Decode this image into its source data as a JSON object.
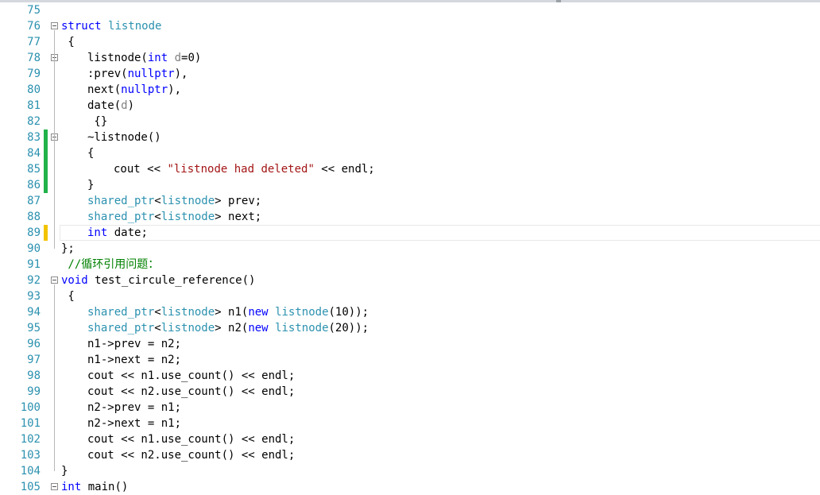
{
  "editor": {
    "lines": [
      {
        "num": "75",
        "indent": 0,
        "fold": false,
        "change": "",
        "tokens": []
      },
      {
        "num": "76",
        "indent": 0,
        "fold": true,
        "change": "",
        "tokens": [
          {
            "t": "struct",
            "c": "kw"
          },
          {
            "t": " "
          },
          {
            "t": "listnode",
            "c": "ty"
          }
        ]
      },
      {
        "num": "77",
        "indent": 0,
        "fold": false,
        "change": "",
        "tokens": [
          {
            "t": " {"
          }
        ]
      },
      {
        "num": "78",
        "indent": 1,
        "fold": true,
        "change": "",
        "tokens": [
          {
            "t": "listnode("
          },
          {
            "t": "int",
            "c": "kw"
          },
          {
            "t": " "
          },
          {
            "t": "d",
            "c": "pm"
          },
          {
            "t": "=0)"
          }
        ]
      },
      {
        "num": "79",
        "indent": 1,
        "fold": false,
        "change": "",
        "tokens": [
          {
            "t": ":prev("
          },
          {
            "t": "nullptr",
            "c": "kw"
          },
          {
            "t": "),"
          }
        ]
      },
      {
        "num": "80",
        "indent": 1,
        "fold": false,
        "change": "",
        "tokens": [
          {
            "t": "next("
          },
          {
            "t": "nullptr",
            "c": "kw"
          },
          {
            "t": "),"
          }
        ]
      },
      {
        "num": "81",
        "indent": 1,
        "fold": false,
        "change": "",
        "tokens": [
          {
            "t": "date("
          },
          {
            "t": "d",
            "c": "pm"
          },
          {
            "t": ")"
          }
        ]
      },
      {
        "num": "82",
        "indent": 1,
        "fold": false,
        "change": "",
        "tokens": [
          {
            "t": " {}"
          }
        ]
      },
      {
        "num": "83",
        "indent": 1,
        "fold": true,
        "change": "saved",
        "tokens": [
          {
            "t": "~listnode()"
          }
        ]
      },
      {
        "num": "84",
        "indent": 1,
        "fold": false,
        "change": "saved",
        "tokens": [
          {
            "t": "{"
          }
        ]
      },
      {
        "num": "85",
        "indent": 2,
        "fold": false,
        "change": "saved",
        "tokens": [
          {
            "t": "cout << "
          },
          {
            "t": "\"listnode had deleted\"",
            "c": "str"
          },
          {
            "t": " << endl;"
          }
        ]
      },
      {
        "num": "86",
        "indent": 1,
        "fold": false,
        "change": "saved",
        "tokens": [
          {
            "t": "}"
          }
        ]
      },
      {
        "num": "87",
        "indent": 1,
        "fold": false,
        "change": "",
        "tokens": [
          {
            "t": "shared_ptr",
            "c": "ty"
          },
          {
            "t": "<"
          },
          {
            "t": "listnode",
            "c": "ty"
          },
          {
            "t": "> prev;"
          }
        ]
      },
      {
        "num": "88",
        "indent": 1,
        "fold": false,
        "change": "",
        "tokens": [
          {
            "t": "shared_ptr",
            "c": "ty"
          },
          {
            "t": "<"
          },
          {
            "t": "listnode",
            "c": "ty"
          },
          {
            "t": "> next;"
          }
        ]
      },
      {
        "num": "89",
        "indent": 1,
        "fold": false,
        "change": "unsaved",
        "current": true,
        "tokens": [
          {
            "t": "int",
            "c": "kw"
          },
          {
            "t": " date;"
          }
        ]
      },
      {
        "num": "90",
        "indent": 0,
        "fold": false,
        "change": "",
        "tokens": [
          {
            "t": "};"
          }
        ]
      },
      {
        "num": "91",
        "indent": 0,
        "fold": false,
        "change": "",
        "tokens": [
          {
            "t": " //循环引用问题：",
            "c": "cm"
          }
        ]
      },
      {
        "num": "92",
        "indent": 0,
        "fold": true,
        "change": "",
        "tokens": [
          {
            "t": "void",
            "c": "kw"
          },
          {
            "t": " test_circule_reference()"
          }
        ]
      },
      {
        "num": "93",
        "indent": 0,
        "fold": false,
        "change": "",
        "tokens": [
          {
            "t": " {"
          }
        ]
      },
      {
        "num": "94",
        "indent": 1,
        "fold": false,
        "change": "",
        "tokens": [
          {
            "t": "shared_ptr",
            "c": "ty"
          },
          {
            "t": "<"
          },
          {
            "t": "listnode",
            "c": "ty"
          },
          {
            "t": "> n1("
          },
          {
            "t": "new",
            "c": "kw"
          },
          {
            "t": " "
          },
          {
            "t": "listnode",
            "c": "ty"
          },
          {
            "t": "(10));"
          }
        ]
      },
      {
        "num": "95",
        "indent": 1,
        "fold": false,
        "change": "",
        "tokens": [
          {
            "t": "shared_ptr",
            "c": "ty"
          },
          {
            "t": "<"
          },
          {
            "t": "listnode",
            "c": "ty"
          },
          {
            "t": "> n2("
          },
          {
            "t": "new",
            "c": "kw"
          },
          {
            "t": " "
          },
          {
            "t": "listnode",
            "c": "ty"
          },
          {
            "t": "(20));"
          }
        ]
      },
      {
        "num": "96",
        "indent": 1,
        "fold": false,
        "change": "",
        "tokens": [
          {
            "t": "n1->prev = n2;"
          }
        ]
      },
      {
        "num": "97",
        "indent": 1,
        "fold": false,
        "change": "",
        "tokens": [
          {
            "t": "n1->next = n2;"
          }
        ]
      },
      {
        "num": "98",
        "indent": 1,
        "fold": false,
        "change": "",
        "tokens": [
          {
            "t": "cout << n1.use_count() << endl;"
          }
        ]
      },
      {
        "num": "99",
        "indent": 1,
        "fold": false,
        "change": "",
        "tokens": [
          {
            "t": "cout << n2.use_count() << endl;"
          }
        ]
      },
      {
        "num": "100",
        "indent": 1,
        "fold": false,
        "change": "",
        "tokens": [
          {
            "t": "n2->prev = n1;"
          }
        ]
      },
      {
        "num": "101",
        "indent": 1,
        "fold": false,
        "change": "",
        "tokens": [
          {
            "t": "n2->next = n1;"
          }
        ]
      },
      {
        "num": "102",
        "indent": 1,
        "fold": false,
        "change": "",
        "tokens": [
          {
            "t": "cout << n1.use_count() << endl;"
          }
        ]
      },
      {
        "num": "103",
        "indent": 1,
        "fold": false,
        "change": "",
        "tokens": [
          {
            "t": "cout << n2.use_count() << endl;"
          }
        ]
      },
      {
        "num": "104",
        "indent": 0,
        "fold": false,
        "change": "",
        "tokens": [
          {
            "t": "}"
          }
        ]
      },
      {
        "num": "105",
        "indent": 0,
        "fold": true,
        "change": "",
        "tokens": [
          {
            "t": "int",
            "c": "kw"
          },
          {
            "t": " main()"
          }
        ]
      }
    ]
  },
  "colors": {
    "keyword": "#0000ff",
    "type": "#2b91af",
    "string": "#a31515",
    "comment": "#008000",
    "line_number": "#2b91af",
    "change_saved": "#21b24a",
    "change_unsaved": "#f2c300"
  }
}
